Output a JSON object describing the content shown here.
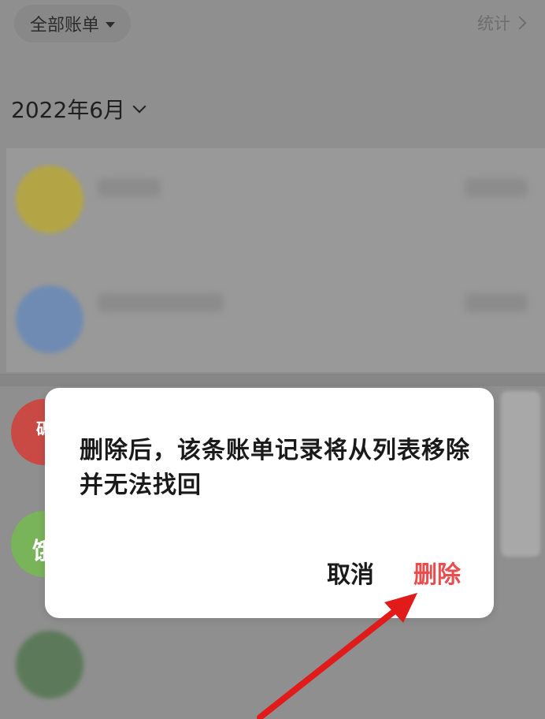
{
  "header": {
    "filter_label": "全部账单",
    "stats_label": "统计"
  },
  "month": {
    "label": "2022年6月"
  },
  "background_list": {
    "avatar_colors": [
      "#b3a545",
      "#6f8bb3",
      "#c94a45",
      "#79b35a",
      "#5c7a5a"
    ],
    "badge_chars": [
      "碼",
      "饿"
    ]
  },
  "dialog": {
    "message": "删除后，该条账单记录将从列表移除并无法找回",
    "cancel_label": "取消",
    "delete_label": "删除",
    "delete_color": "#ea4d4d"
  },
  "annotation": {
    "arrow_color": "#e11a1a",
    "icon": "red-arrow-icon"
  }
}
